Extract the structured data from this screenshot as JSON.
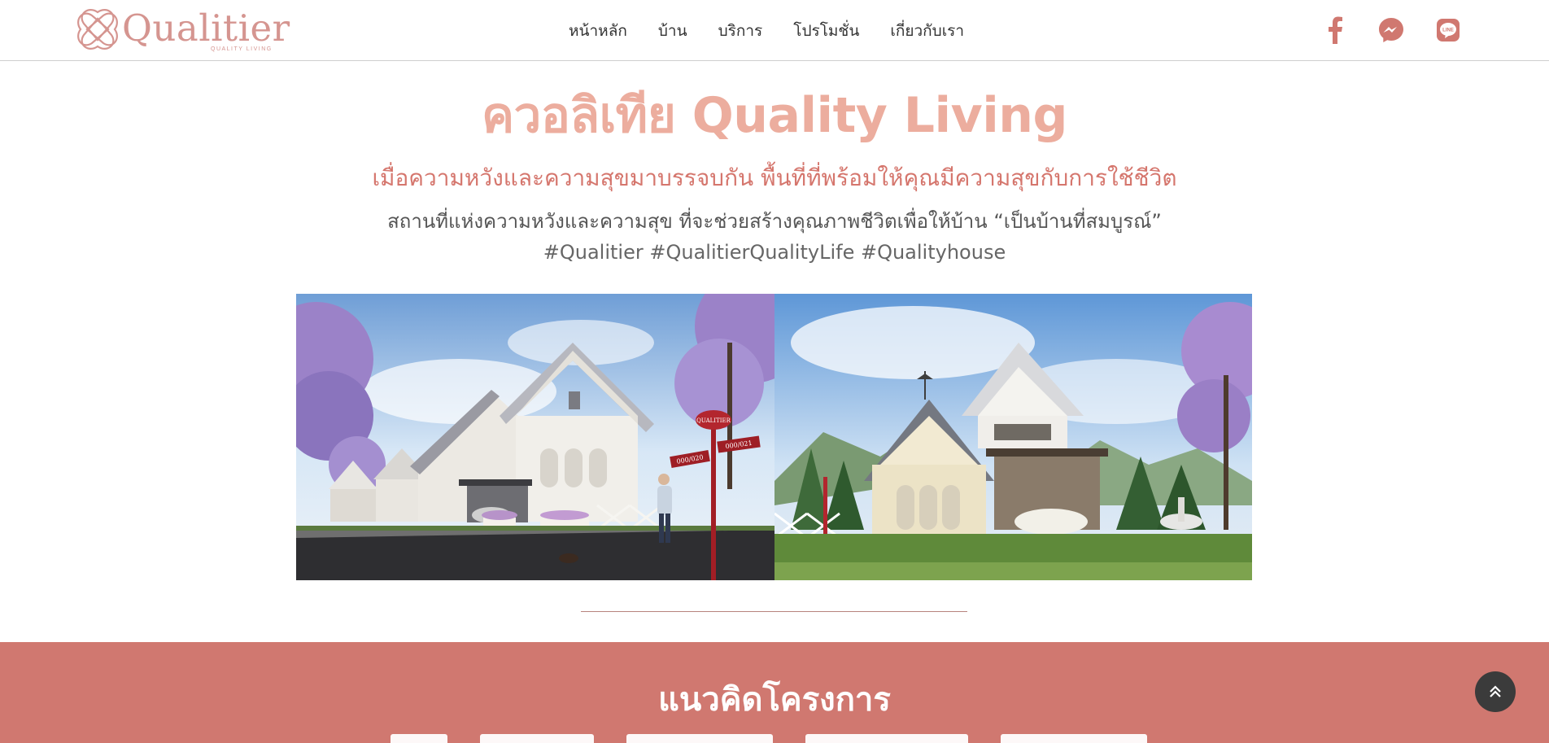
{
  "brand": {
    "name": "Qualitier",
    "tagline": "QUALITY   LIVING",
    "color": "#d59590"
  },
  "nav": {
    "items": [
      {
        "label": "หน้าหลัก"
      },
      {
        "label": "บ้าน"
      },
      {
        "label": "บริการ"
      },
      {
        "label": "โปรโมชั่น"
      },
      {
        "label": "เกี่ยวกับเรา"
      }
    ]
  },
  "social": {
    "icons": [
      "facebook-icon",
      "messenger-icon",
      "line-icon"
    ],
    "color": "#d07870"
  },
  "hero": {
    "title": "ควอลิเทีย Quality Living",
    "subtitle": "เมื่อความหวังและความสุขมาบรรจบกัน พื้นที่ที่พร้อมให้คุณมีความสุขกับการใช้ชีวิต",
    "description": "สถานที่แห่งความหวังและความสุข ที่จะช่วยสร้างคุณภาพชีวิตเพื่อให้บ้าน “เป็นบ้านที่สมบูรณ์”",
    "hashtags": "#Qualitier #QualitierQualityLife #Qualityhouse",
    "title_color": "#ecad9e",
    "subtitle_color": "#d5766d"
  },
  "photos": {
    "left_sign_main": "QUALITIER",
    "left_sign_a": "000/020",
    "left_sign_b": "000/021"
  },
  "concept": {
    "title": "แนวคิดโครงการ",
    "background": "#d07870"
  },
  "scroll_top": {
    "icon": "double-chevron-up-icon"
  }
}
